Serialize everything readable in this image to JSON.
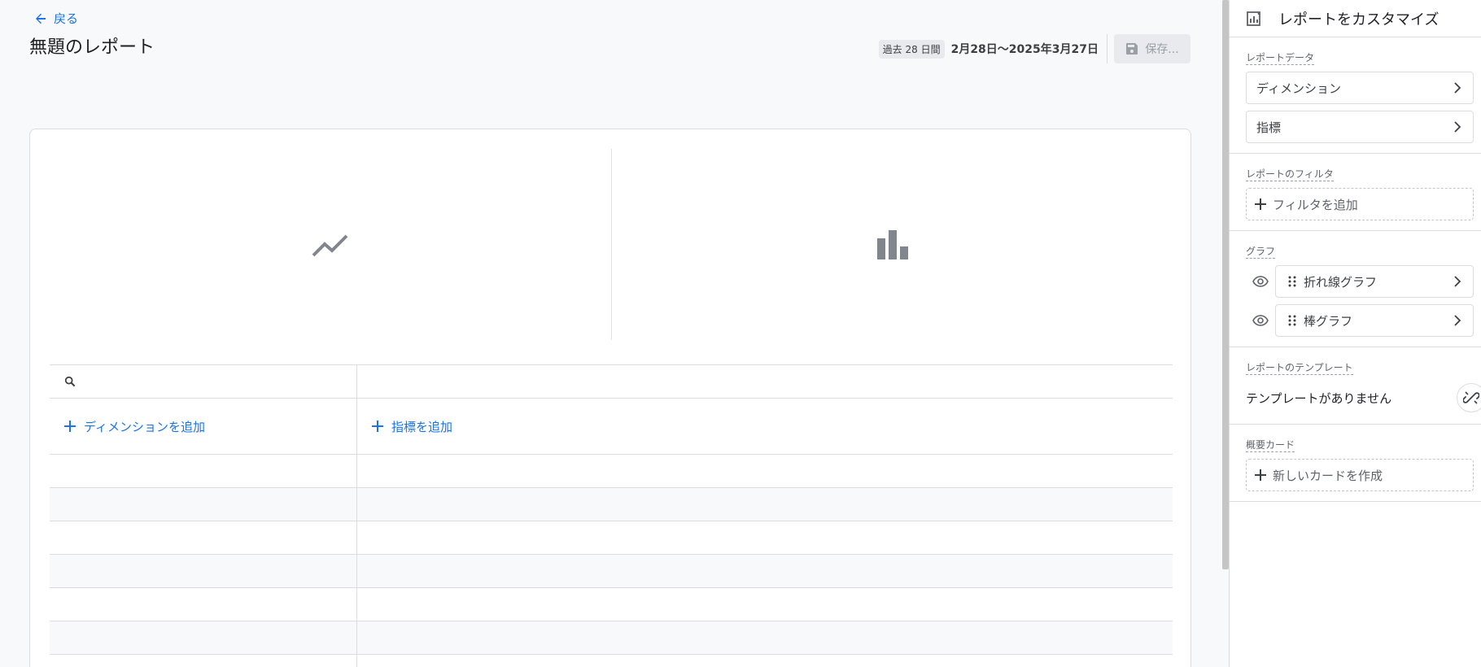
{
  "header": {
    "back_label": "戻る",
    "title": "無題のレポート",
    "date_chip": "過去 28 日間",
    "date_range": "2月28日〜2025年3月27日",
    "save_label": "保存..."
  },
  "charts": {
    "left_icon": "line-chart-icon",
    "right_icon": "bar-chart-icon"
  },
  "table": {
    "add_dimension": "ディメンションを追加",
    "add_metric": "指標を追加",
    "empty_rows": 7
  },
  "panel": {
    "title": "レポートをカスタマイズ",
    "report_data": {
      "label": "レポートデータ",
      "dimensions": "ディメンション",
      "metrics": "指標"
    },
    "filters": {
      "label": "レポートのフィルタ",
      "add_filter": "フィルタを追加"
    },
    "graphs": {
      "label": "グラフ",
      "items": [
        {
          "label": "折れ線グラフ"
        },
        {
          "label": "棒グラフ"
        }
      ]
    },
    "templates": {
      "label": "レポートのテンプレート",
      "empty": "テンプレートがありません"
    },
    "summary_cards": {
      "label": "概要カード",
      "create": "新しいカードを作成"
    }
  },
  "colors": {
    "accent": "#1a73e8",
    "icon_gray": "#80868b",
    "border": "#dadce0"
  }
}
